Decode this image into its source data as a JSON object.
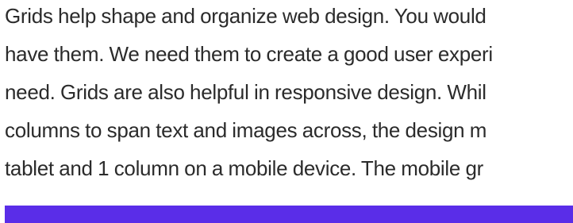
{
  "article": {
    "lines": [
      "Grids help shape and organize web design. You would",
      "have them. We need them to create a good user experi",
      "need. Grids are also helpful in responsive design. Whil",
      "columns to span text and images across, the design m",
      "tablet and 1 column on a mobile device. The mobile gr"
    ]
  },
  "colors": {
    "text": "#2b2b2b",
    "accent_bar": "#5a2de8",
    "background": "#ffffff"
  }
}
